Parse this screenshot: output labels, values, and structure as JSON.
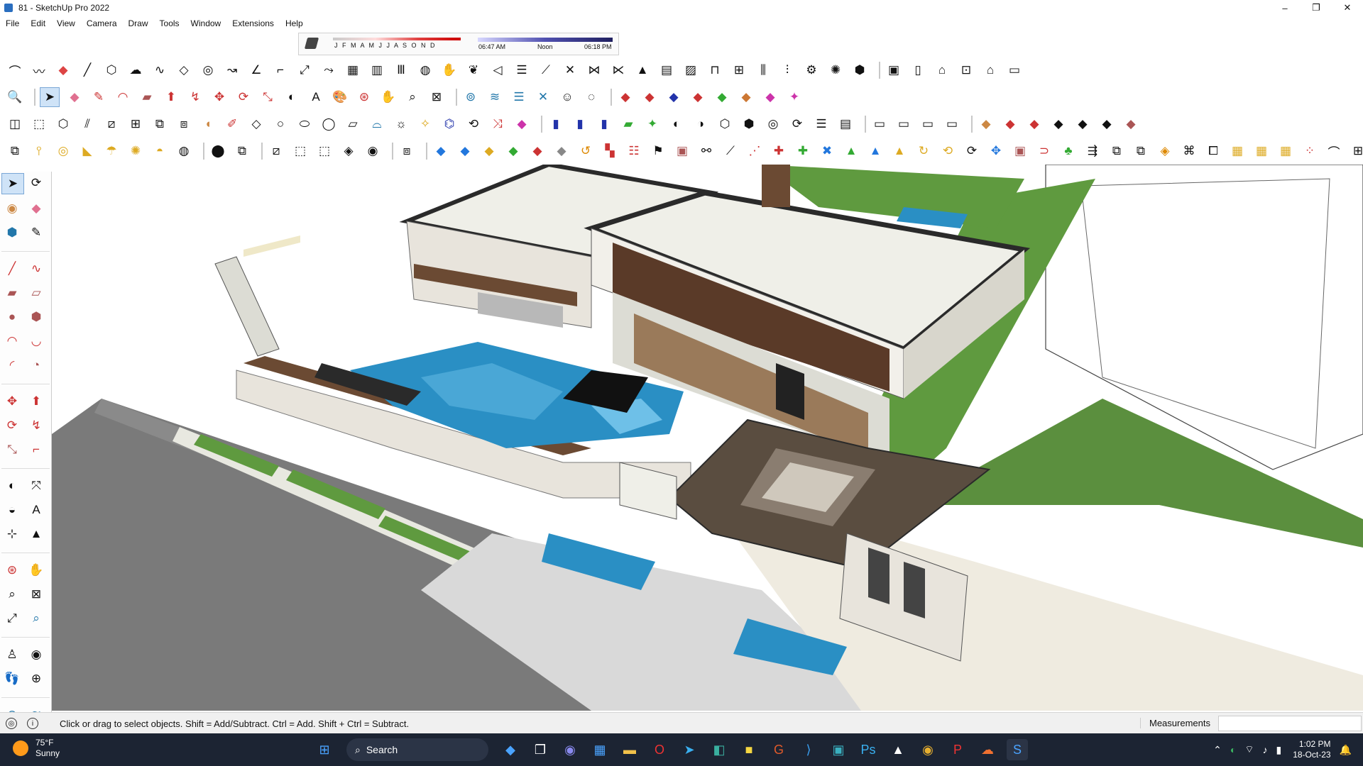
{
  "window": {
    "title": "81 - SketchUp Pro 2022",
    "minimize": "–",
    "restore": "❐",
    "close": "✕"
  },
  "menu": [
    "File",
    "Edit",
    "View",
    "Camera",
    "Draw",
    "Tools",
    "Window",
    "Extensions",
    "Help"
  ],
  "shadows": {
    "months": "J F M A M J J A S O N D",
    "time_start": "06:47 AM",
    "time_noon": "Noon",
    "time_end": "06:18 PM"
  },
  "status": {
    "hint": "Click or drag to select objects. Shift = Add/Subtract. Ctrl = Add. Shift + Ctrl = Subtract.",
    "measurements_label": "Measurements",
    "measurements_value": ""
  },
  "taskbar": {
    "temperature": "75°F",
    "condition": "Sunny",
    "search_placeholder": "Search",
    "time": "1:02 PM",
    "date": "18-Oct-23"
  },
  "colors": {
    "lawn": "#5f9a3f",
    "pool": "#2a8fc4",
    "road": "#7a7a7a",
    "roof": "#efefe8",
    "wall": "#e8e4dc",
    "wood": "#6b4a33",
    "trim": "#2a2a2a"
  },
  "toolbar_icons": {
    "row1": [
      "arc-icon",
      "freehand-icon",
      "eraser-icon",
      "line-icon",
      "polygon-icon",
      "cloud-icon",
      "wave-icon",
      "layer-icon",
      "circle-icon",
      "curve-icon",
      "angle-icon",
      "offset-icon",
      "scale-icon",
      "path-icon",
      "frame-icon",
      "house-icon"
    ],
    "row2": [
      "zoom-icon",
      "select-icon",
      "eraser-icon",
      "pencil-icon",
      "arc-icon",
      "rectangle-icon",
      "push-pull-icon",
      "move-icon",
      "rotate-icon",
      "scale-icon",
      "tape-icon",
      "text-icon",
      "paint-icon",
      "orbit-icon",
      "pan-icon",
      "zoom-window-icon"
    ],
    "row3": [
      "camera-icon",
      "box-icon",
      "component-icon",
      "section-icon",
      "tag-icon",
      "pen-icon",
      "shapes-icon",
      "circle-icon",
      "ellipse-icon",
      "path-icon",
      "sun-icon",
      "rotate-icon"
    ],
    "row4": [
      "solid-tools-icon",
      "sandbox-icon",
      "warehouse-icon",
      "bricks-icon",
      "gear-icon",
      "extension-icon"
    ]
  }
}
